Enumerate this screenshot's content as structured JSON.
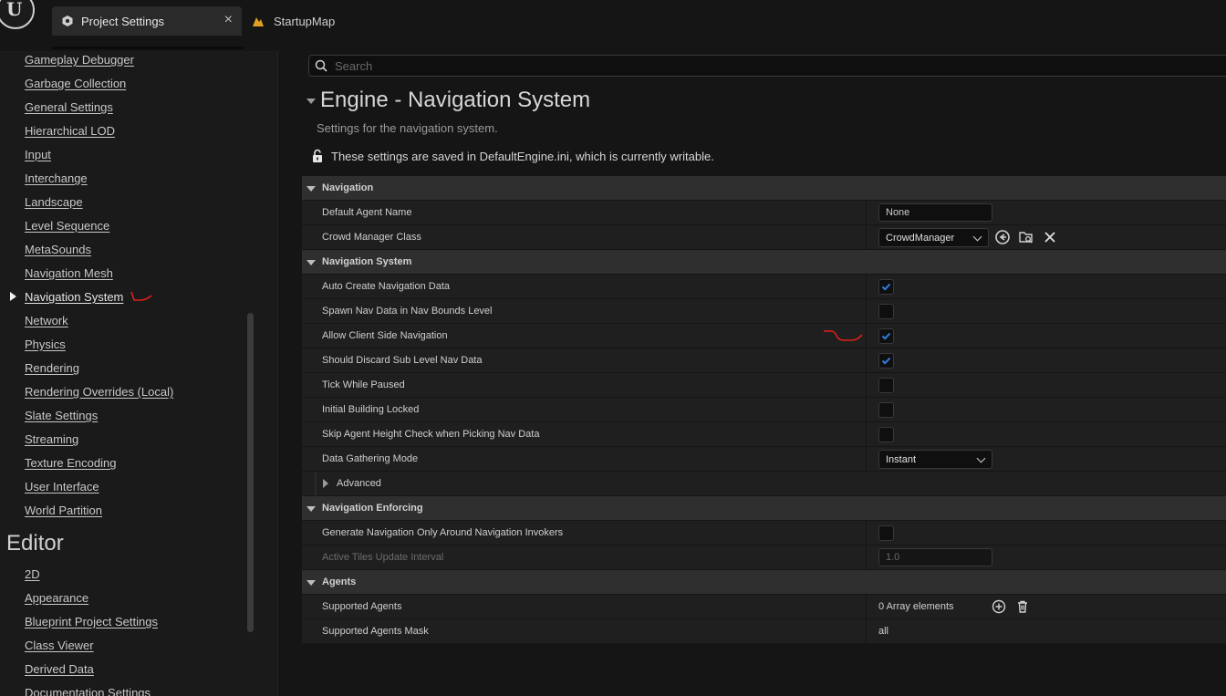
{
  "titlebar": {
    "tabs": [
      {
        "label": "Project Settings",
        "icon": "settings-cube-icon",
        "active": true
      },
      {
        "label": "StartupMap",
        "icon": "map-icon",
        "active": false
      }
    ],
    "close_glyph": "×"
  },
  "sidebar": {
    "items": [
      "Gameplay Debugger",
      "Garbage Collection",
      "General Settings",
      "Hierarchical LOD",
      "Input",
      "Interchange",
      "Landscape",
      "Level Sequence",
      "MetaSounds",
      "Navigation Mesh",
      "Navigation System",
      "Network",
      "Physics",
      "Rendering",
      "Rendering Overrides (Local)",
      "Slate Settings",
      "Streaming",
      "Texture Encoding",
      "User Interface",
      "World Partition"
    ],
    "selected": "Navigation System",
    "editor_header": "Editor",
    "editor_items": [
      "2D",
      "Appearance",
      "Blueprint Project Settings",
      "Class Viewer",
      "Derived Data",
      "Documentation Settings"
    ]
  },
  "main": {
    "search_placeholder": "Search",
    "title": "Engine - Navigation System",
    "description": "Settings for the navigation system.",
    "saved_note": "These settings are saved in DefaultEngine.ini, which is currently writable.",
    "categories": {
      "navigation": {
        "label": "Navigation",
        "default_agent_name": {
          "label": "Default Agent Name",
          "value": "None"
        },
        "crowd_manager_class": {
          "label": "Crowd Manager Class",
          "value": "CrowdManager"
        }
      },
      "navigation_system": {
        "label": "Navigation System",
        "auto_create": {
          "label": "Auto Create Navigation Data",
          "checked": true
        },
        "spawn_nav_data": {
          "label": "Spawn Nav Data in Nav Bounds Level",
          "checked": false
        },
        "allow_client_side": {
          "label": "Allow Client Side Navigation",
          "checked": true
        },
        "discard_sub_level": {
          "label": "Should Discard Sub Level Nav Data",
          "checked": true
        },
        "tick_while_paused": {
          "label": "Tick While Paused",
          "checked": false
        },
        "initial_building_locked": {
          "label": "Initial Building Locked",
          "checked": false
        },
        "skip_agent_height": {
          "label": "Skip Agent Height Check when Picking Nav Data",
          "checked": false
        },
        "data_gathering_mode": {
          "label": "Data Gathering Mode",
          "value": "Instant"
        },
        "advanced": {
          "label": "Advanced"
        }
      },
      "navigation_enforcing": {
        "label": "Navigation Enforcing",
        "generate_only_around_invokers": {
          "label": "Generate Navigation Only Around Navigation Invokers",
          "checked": false
        },
        "active_tiles_update_interval": {
          "label": "Active Tiles Update Interval",
          "value": "1.0"
        }
      },
      "agents": {
        "label": "Agents",
        "supported_agents": {
          "label": "Supported Agents",
          "value": "0 Array elements"
        },
        "supported_agents_mask": {
          "label": "Supported Agents Mask",
          "value": "all"
        }
      }
    }
  },
  "colors": {
    "accent_check": "#2f7fe0",
    "annotation_red": "#e0201a"
  }
}
